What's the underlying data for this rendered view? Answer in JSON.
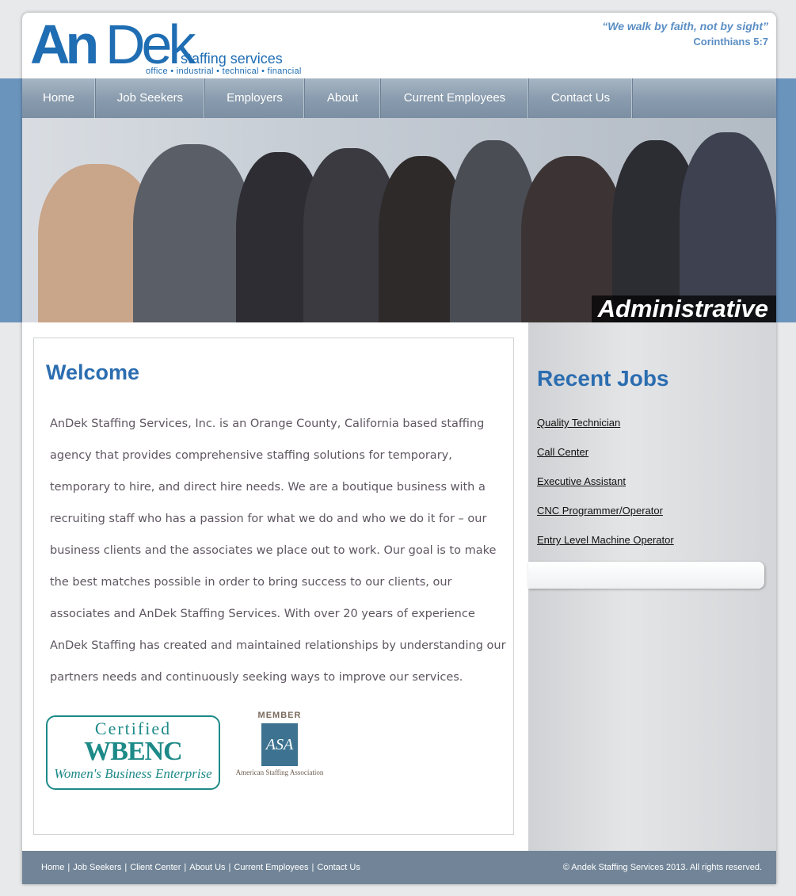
{
  "header": {
    "logo_an": "An",
    "logo_dek": "Dek",
    "logo_staffing": "staffing services",
    "logo_sub": "office • industrial • technical • financial",
    "quote": "“We walk by faith, not by sight”",
    "quote_ref": "Corinthians 5:7"
  },
  "nav": [
    {
      "label": "Home"
    },
    {
      "label": "Job Seekers"
    },
    {
      "label": "Employers"
    },
    {
      "label": "About"
    },
    {
      "label": "Current Employees"
    },
    {
      "label": "Contact Us"
    }
  ],
  "banner": {
    "caption": "Administrative"
  },
  "welcome": {
    "title": "Welcome",
    "body": "AnDek Staffing Services, Inc. is an Orange County, California based staffing agency that provides comprehensive staffing solutions for temporary, temporary to hire, and direct hire needs.  We are a boutique business with a recruiting staff who has a passion for what we do and who we do it for – our business clients and the associates we place out to work. Our goal is to make the best matches possible in order to bring success to our clients, our associates and AnDek Staffing Services. With over 20 years of experience AnDek Staffing has created and maintained relationships by understanding our partners needs and continuously seeking ways to improve our services."
  },
  "badges": {
    "wbenc_certified": "Certified",
    "wbenc_name": "WBENC",
    "wbenc_sub": "Women's Business Enterprise",
    "asa_member": "MEMBER",
    "asa_logo": "ASA",
    "asa_name": "American Staffing Association"
  },
  "sidebar": {
    "title": "Recent Jobs",
    "jobs": [
      {
        "label": "Quality Technician"
      },
      {
        "label": "Call Center"
      },
      {
        "label": "Executive Assistant"
      },
      {
        "label": "CNC Programmer/Operator"
      },
      {
        "label": "Entry Level Machine Operator"
      }
    ]
  },
  "footer": {
    "links": [
      {
        "label": "Home"
      },
      {
        "label": "Job Seekers"
      },
      {
        "label": "Client Center"
      },
      {
        "label": "About Us"
      },
      {
        "label": "Current Employees"
      },
      {
        "label": "Contact Us"
      }
    ],
    "separator": "|",
    "copyright": "© Andek Staffing Services 2013. All rights reserved."
  },
  "colors": {
    "brand_blue": "#1f6db3",
    "heading_blue": "#2b6db0",
    "band_blue": "#6b94bd",
    "footer_bg": "#728598"
  }
}
